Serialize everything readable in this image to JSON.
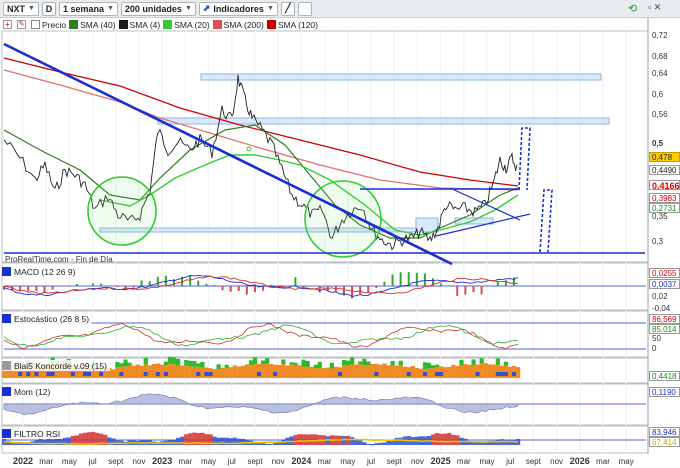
{
  "toolbar": {
    "symbol": "NXT",
    "d_label": "D",
    "timeframe": "1 semana",
    "units": "200 unidades",
    "indicators": "Indicadores"
  },
  "legend": {
    "price": "Precio",
    "sma40": "SMA (40)",
    "sma4": "SMA (4)",
    "sma20": "SMA (20)",
    "sma200": "SMA (200)",
    "sma120": "SMA (120)"
  },
  "footer": "ProRealTime.com - Fin de Día",
  "panels": {
    "macd": "MACD (12 26 9)",
    "stoch": "Estocástico (26 8 5)",
    "koncorde": "Blai5 Koncorde v.09 (15)",
    "mom": "Mom (12)",
    "rsi": "FILTRO RSI"
  },
  "price_axis": [
    "0,72",
    "0,68",
    "0,64",
    "0,6",
    "0,56",
    "0,5",
    "0,35",
    "0,3"
  ],
  "price_tags": {
    "last": "0,478",
    "t2": "0,4490",
    "t3": "0,4166",
    "t4": "0,3983",
    "t5": "0,2731"
  },
  "macd_axis": [
    "0,02",
    "-0,04"
  ],
  "macd_tags": [
    "0,0255",
    "0,0037"
  ],
  "stoch_axis": [
    "50",
    "0"
  ],
  "stoch_tags": [
    "86,569",
    "85,014"
  ],
  "koncorde_tag": "0,4418",
  "mom_tag": "0,1190",
  "rsi_tags": [
    "83,946",
    "67,414"
  ],
  "x_axis": [
    {
      "t": "2022",
      "year": true
    },
    {
      "t": "mar"
    },
    {
      "t": "may"
    },
    {
      "t": "jul"
    },
    {
      "t": "sept"
    },
    {
      "t": "nov"
    },
    {
      "t": "2023",
      "year": true
    },
    {
      "t": "mar"
    },
    {
      "t": "may"
    },
    {
      "t": "jul"
    },
    {
      "t": "sept"
    },
    {
      "t": "nov"
    },
    {
      "t": "2024",
      "year": true
    },
    {
      "t": "mar"
    },
    {
      "t": "may"
    },
    {
      "t": "jul"
    },
    {
      "t": "sept"
    },
    {
      "t": "nov"
    },
    {
      "t": "2025",
      "year": true
    },
    {
      "t": "mar"
    },
    {
      "t": "may"
    },
    {
      "t": "jul"
    },
    {
      "t": "sept"
    },
    {
      "t": "nov"
    },
    {
      "t": "2026",
      "year": true
    },
    {
      "t": "mar"
    },
    {
      "t": "may"
    }
  ],
  "colors": {
    "price": "#222222",
    "sma40": "#2e7d1e",
    "sma4": "#1a1a1a",
    "sma20": "#33cc33",
    "sma200": "#e05050",
    "sma120": "#cc0000",
    "trendline": "#1a2fd0",
    "box": "#a9c7ee"
  }
}
